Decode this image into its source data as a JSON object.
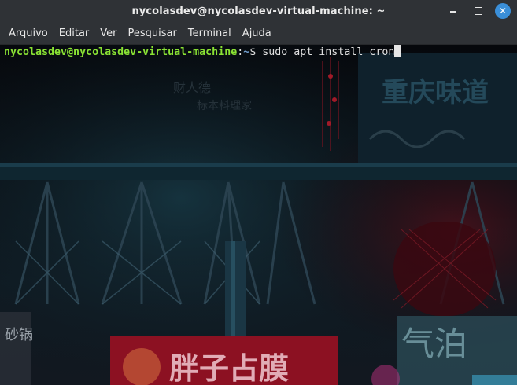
{
  "window": {
    "title": "nycolasdev@nycolasdev-virtual-machine: ~"
  },
  "menu": {
    "items": [
      "Arquivo",
      "Editar",
      "Ver",
      "Pesquisar",
      "Terminal",
      "Ajuda"
    ]
  },
  "terminal": {
    "prompt_user_host": "nycolasdev@nycolasdev-virtual-machine",
    "prompt_separator": ":",
    "prompt_path": "~",
    "prompt_symbol": "$ ",
    "command": "sudo apt install cron"
  },
  "colors": {
    "prompt_user": "#8ae234",
    "prompt_path": "#729fcf",
    "close_button": "#3a8fd9",
    "chrome": "#2f3236"
  }
}
